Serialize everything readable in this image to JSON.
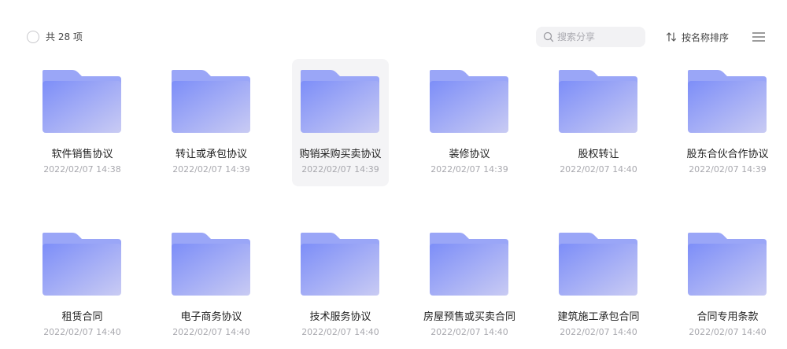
{
  "toolbar": {
    "count_label": "共 28 项",
    "search_placeholder": "搜索分享",
    "sort_label": "按名称排序"
  },
  "colors": {
    "folder_light": "#c9cbf3",
    "folder_main": "#7d8ef8",
    "folder_tab": "#9aa6f7",
    "hover_bg": "#f4f4f6"
  },
  "files": [
    {
      "name": "软件销售协议",
      "date": "2022/02/07 14:38"
    },
    {
      "name": "转让或承包协议",
      "date": "2022/02/07 14:39"
    },
    {
      "name": "购销采购买卖协议",
      "date": "2022/02/07 14:39"
    },
    {
      "name": "装修协议",
      "date": "2022/02/07 14:39"
    },
    {
      "name": "股权转让",
      "date": "2022/02/07 14:40"
    },
    {
      "name": "股东合伙合作协议",
      "date": "2022/02/07 14:39"
    },
    {
      "name": "租赁合同",
      "date": "2022/02/07 14:40"
    },
    {
      "name": "电子商务协议",
      "date": "2022/02/07 14:40"
    },
    {
      "name": "技术服务协议",
      "date": "2022/02/07 14:40"
    },
    {
      "name": "房屋预售或买卖合同",
      "date": "2022/02/07 14:40"
    },
    {
      "name": "建筑施工承包合同",
      "date": "2022/02/07 14:40"
    },
    {
      "name": "合同专用条款",
      "date": "2022/02/07 14:40"
    }
  ]
}
